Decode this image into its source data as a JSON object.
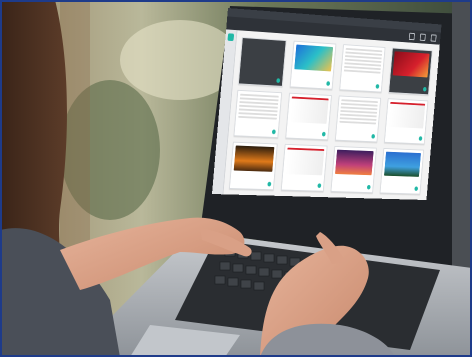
{
  "scene": {
    "description_free": true,
    "colors": {
      "frame_border": "#1e3b8a",
      "accent": "#21b8a6",
      "app_dark": "#2e3238",
      "wall_gray": "#4a4e53"
    },
    "icons": [
      "document-icon",
      "search-icon",
      "gear-icon",
      "keyboard"
    ]
  },
  "screen": {
    "window_title": "",
    "breadcrumb": ""
  },
  "cards": [
    {
      "style": "dark"
    },
    {
      "style": "photo",
      "thumb": "t1"
    },
    {
      "style": "doc",
      "thumb": "t6"
    },
    {
      "style": "dark",
      "thumb": "t2"
    },
    {
      "style": "doc",
      "thumb": "t6"
    },
    {
      "style": "doc",
      "thumb": "t7"
    },
    {
      "style": "doc",
      "thumb": "t6"
    },
    {
      "style": "doc",
      "thumb": "t7"
    },
    {
      "style": "photo",
      "thumb": "t3"
    },
    {
      "style": "doc",
      "thumb": "t7"
    },
    {
      "style": "photo",
      "thumb": "t4"
    },
    {
      "style": "photo",
      "thumb": "t5"
    }
  ]
}
